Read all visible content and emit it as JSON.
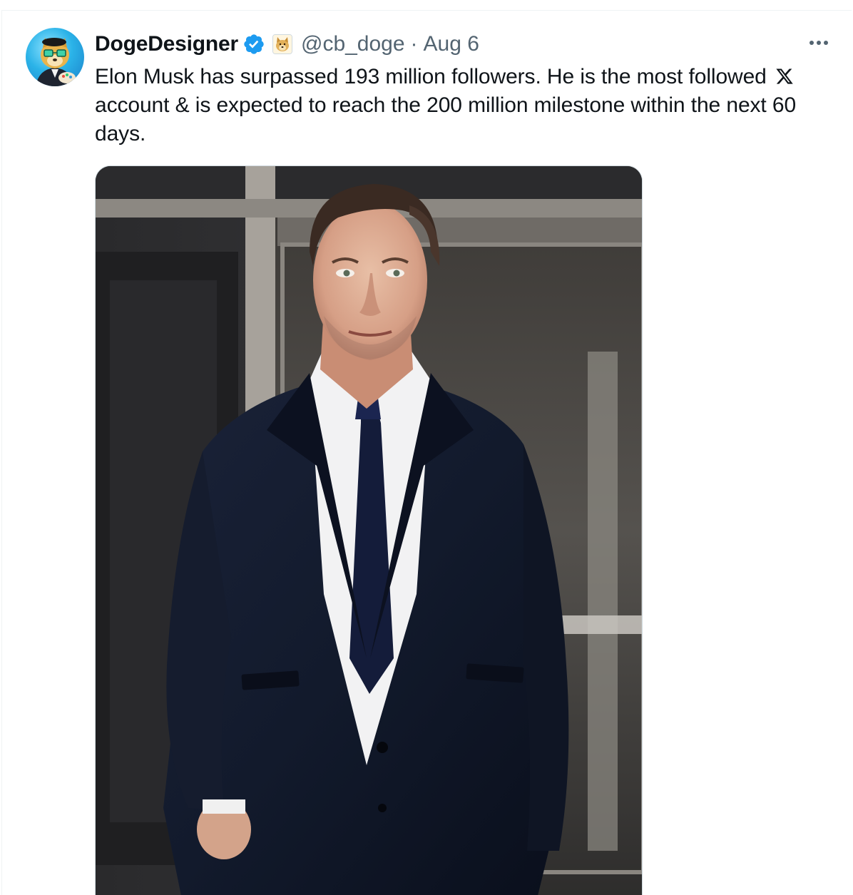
{
  "tweet": {
    "author": {
      "display_name": "DogeDesigner",
      "handle": "@cb_doge",
      "verified": true,
      "avatar_icon": "doge-artist-avatar",
      "affiliate_badge_icon": "doge-badge"
    },
    "separator": "·",
    "timestamp": "Aug 6",
    "text_before_logo": "Elon Musk has surpassed 193 million followers. He is the most followed",
    "inline_logo_icon": "x-logo-icon",
    "text_after_logo": " account & is expected to reach the 200 million milestone within the next 60 days.",
    "media": {
      "kind": "photo",
      "alt_description": "Man in a dark suit and tie walking out of a glass building entrance"
    }
  },
  "colors": {
    "text_primary": "#0f1419",
    "text_secondary": "#536471",
    "verified_blue": "#1d9bf0",
    "border": "#cfd9de"
  }
}
